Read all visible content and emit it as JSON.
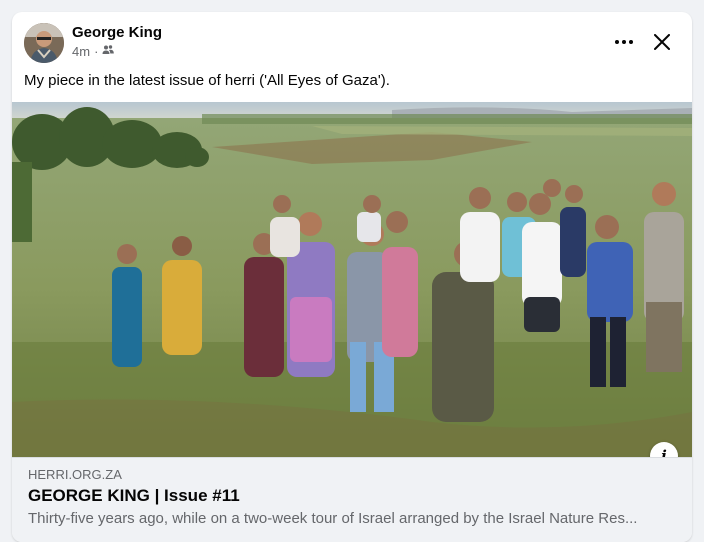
{
  "post": {
    "author": "George King",
    "time": "4m",
    "separator": "·",
    "audience_icon": "friends-icon",
    "caption": "My piece in the latest issue of herri ('All Eyes of Gaza').",
    "more_icon": "more-options-icon",
    "close_icon": "close-icon"
  },
  "link_preview": {
    "domain": "HERRI.ORG.ZA",
    "title": "GEORGE KING | Issue #11",
    "description": "Thirty-five years ago, while on a two-week tour of Israel arranged by the Israel Nature Res...",
    "info_icon": "info-icon",
    "info_glyph": "i"
  },
  "colors": {
    "background": "#f0f2f5",
    "card": "#ffffff",
    "secondary_text": "#65676b",
    "primary_text": "#050505"
  }
}
